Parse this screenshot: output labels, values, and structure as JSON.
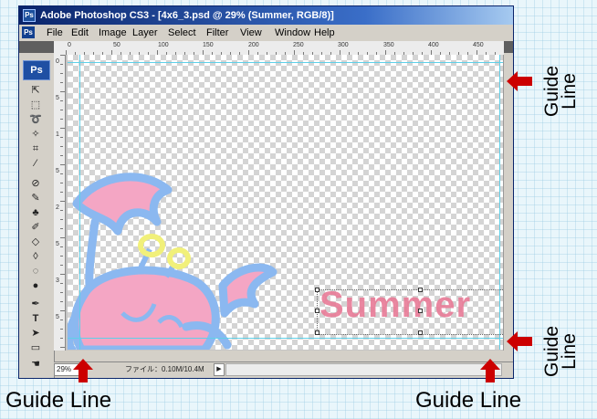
{
  "window": {
    "title": "Adobe Photoshop CS3 - [4x6_3.psd @ 29% (Summer, RGB/8)]",
    "ps_badge": "Ps"
  },
  "menu": {
    "items": [
      "File",
      "Edit",
      "Image",
      "Layer",
      "Select",
      "Filter",
      "View",
      "Window",
      "Help"
    ]
  },
  "ruler": {
    "h_labels": [
      "0",
      "50",
      "100",
      "150",
      "200",
      "250",
      "300",
      "350",
      "400",
      "450"
    ],
    "v_labels": [
      "0",
      "5",
      "1",
      "5",
      "2",
      "5",
      "3",
      "5"
    ]
  },
  "layer_text": "Summer",
  "status": {
    "zoom": "29%",
    "doc_info": "ファイル：0.10M/10.4M",
    "nav_arrow": "▶"
  },
  "annotations": {
    "guide_top_right": "Guide\nLine",
    "guide_bottom_right": "Guide\nLine",
    "guide_bottom_left": "Guide Line",
    "guide_bottom_right_lower": "Guide Line"
  },
  "colors": {
    "arrow": "#cc0000",
    "guide": "#5fd0e8",
    "crab_fill": "#f4a6c4",
    "crab_outline": "#8bb8f0",
    "text_pink": "#e87b97",
    "eye_yellow": "#f1f07a"
  }
}
